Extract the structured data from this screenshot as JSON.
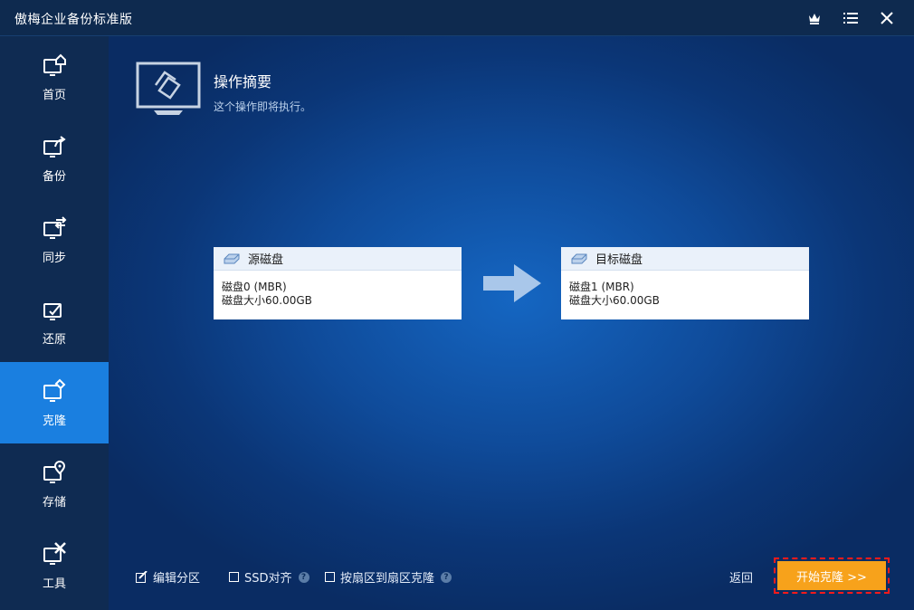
{
  "app": {
    "title": "傲梅企业备份标准版"
  },
  "titlebar": {
    "icons": [
      "crown-icon",
      "menu-icon",
      "close-icon"
    ]
  },
  "sidebar": {
    "items": [
      {
        "label": "首页",
        "icon": "home-icon",
        "active": false
      },
      {
        "label": "备份",
        "icon": "backup-icon",
        "active": false
      },
      {
        "label": "同步",
        "icon": "sync-icon",
        "active": false
      },
      {
        "label": "还原",
        "icon": "restore-icon",
        "active": false
      },
      {
        "label": "克隆",
        "icon": "clone-icon",
        "active": true
      },
      {
        "label": "存储",
        "icon": "storage-icon",
        "active": false
      },
      {
        "label": "工具",
        "icon": "tools-icon",
        "active": false
      }
    ]
  },
  "summary": {
    "title": "操作摘要",
    "subtitle": "这个操作即将执行。"
  },
  "source": {
    "header": "源磁盘",
    "line1": "磁盘0 (MBR)",
    "line2": "磁盘大小60.00GB"
  },
  "target": {
    "header": "目标磁盘",
    "line1": "磁盘1 (MBR)",
    "line2": "磁盘大小60.00GB"
  },
  "options": {
    "edit_partition": {
      "label": "编辑分区",
      "checked": true
    },
    "ssd_align": {
      "label": "SSD对齐",
      "checked": false
    },
    "sector_clone": {
      "label": "按扇区到扇区克隆",
      "checked": false
    }
  },
  "actions": {
    "back": "返回",
    "start": "开始克隆 >>"
  },
  "colors": {
    "accent": "#1a7fe0",
    "start_button": "#f7a21b",
    "highlight_border": "#ff1a1a"
  }
}
